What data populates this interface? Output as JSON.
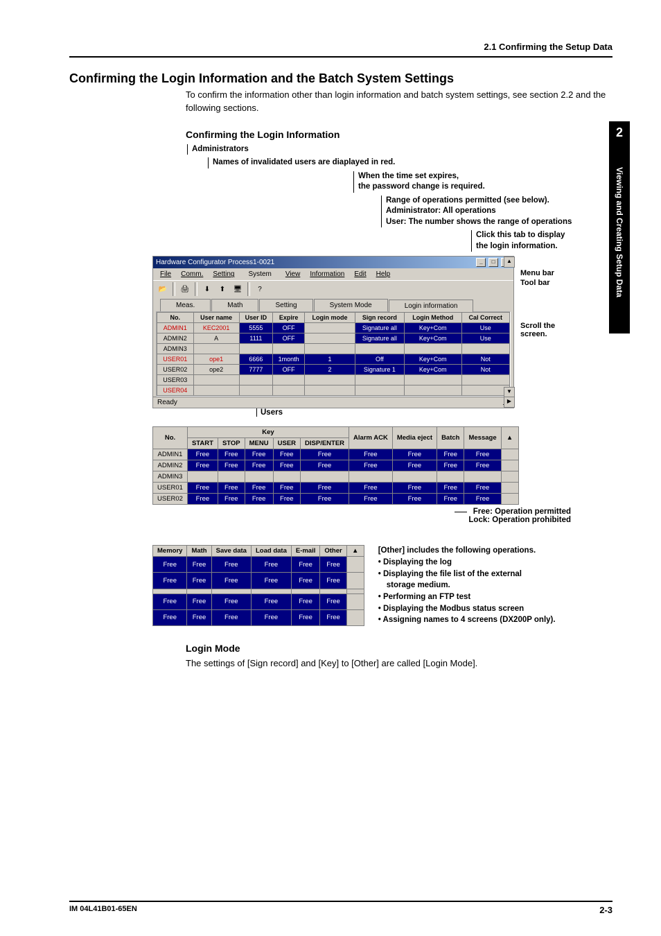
{
  "header": {
    "section": "2.1  Confirming the Setup Data"
  },
  "main_heading": "Confirming the Login Information and the Batch System Settings",
  "intro": "To confirm the information other than login information and batch system settings, see section 2.2 and the following sections.",
  "sub_heading": "Confirming the Login Information",
  "callouts": {
    "administrators": "Administrators",
    "invalid_users": "Names of invalidated users are diaplayed in red.",
    "expire1": "When the time set expires,",
    "expire2": "the password change is required.",
    "range1": "Range of operations permitted (see below).",
    "range2": "Administrator: All operations",
    "range3": "User: The number shows the range of operations",
    "click1": "Click this tab to display",
    "click2": "the login information.",
    "menubar": "Menu bar",
    "toolbar": "Tool bar",
    "scroll1": "Scroll the",
    "scroll2": "screen.",
    "users": "Users"
  },
  "window": {
    "title": "Hardware Configurator Process1-0021",
    "menus": [
      "File",
      "Comm.",
      "Setting",
      "System",
      "View",
      "Information",
      "Edit",
      "Help"
    ],
    "tabs": [
      "Meas.",
      "Math",
      "Setting",
      "System Mode",
      "Login information"
    ],
    "status": "Ready"
  },
  "login_table": {
    "headers": [
      "No.",
      "User name",
      "User ID",
      "Expire",
      "Login mode",
      "Sign record",
      "Login Method",
      "Cal Correct"
    ],
    "rows": [
      {
        "no": "ADMIN1",
        "user": "KEC2001",
        "uid": "5555",
        "exp": "OFF",
        "lm": "",
        "sr": "Signature all",
        "lmeth": "Key+Com",
        "cc": "Use",
        "red": true
      },
      {
        "no": "ADMIN2",
        "user": "A",
        "uid": "1111",
        "exp": "OFF",
        "lm": "",
        "sr": "Signature all",
        "lmeth": "Key+Com",
        "cc": "Use",
        "red": false
      },
      {
        "no": "ADMIN3",
        "user": "",
        "uid": "",
        "exp": "",
        "lm": "",
        "sr": "",
        "lmeth": "",
        "cc": "",
        "red": false
      },
      {
        "no": "USER01",
        "user": "ope1",
        "uid": "6666",
        "exp": "1month",
        "lm": "1",
        "sr": "Off",
        "lmeth": "Key+Com",
        "cc": "Not",
        "red": true
      },
      {
        "no": "USER02",
        "user": "ope2",
        "uid": "7777",
        "exp": "OFF",
        "lm": "2",
        "sr": "Signature 1",
        "lmeth": "Key+Com",
        "cc": "Not",
        "red": false
      },
      {
        "no": "USER03",
        "user": "",
        "uid": "",
        "exp": "",
        "lm": "",
        "sr": "",
        "lmeth": "",
        "cc": "",
        "red": false
      },
      {
        "no": "USER04",
        "user": "",
        "uid": "",
        "exp": "",
        "lm": "",
        "sr": "",
        "lmeth": "",
        "cc": "",
        "red": true
      }
    ]
  },
  "key_table": {
    "header_top": "Key",
    "headers": [
      "No.",
      "START",
      "STOP",
      "MENU",
      "USER",
      "DISP/ENTER",
      "Alarm ACK",
      "Media eject",
      "Batch",
      "Message"
    ],
    "rows": [
      {
        "no": "ADMIN1",
        "cells": [
          "Free",
          "Free",
          "Free",
          "Free",
          "Free",
          "Free",
          "Free",
          "Free",
          "Free"
        ]
      },
      {
        "no": "ADMIN2",
        "cells": [
          "Free",
          "Free",
          "Free",
          "Free",
          "Free",
          "Free",
          "Free",
          "Free",
          "Free"
        ]
      },
      {
        "no": "ADMIN3",
        "cells": [
          "",
          "",
          "",
          "",
          "",
          "",
          "",
          "",
          ""
        ]
      },
      {
        "no": "USER01",
        "cells": [
          "Free",
          "Free",
          "Free",
          "Free",
          "Free",
          "Free",
          "Free",
          "Free",
          "Free"
        ]
      },
      {
        "no": "USER02",
        "cells": [
          "Free",
          "Free",
          "Free",
          "Free",
          "Free",
          "Free",
          "Free",
          "Free",
          "Free"
        ]
      }
    ]
  },
  "legend": {
    "free": "Free: Operation permitted",
    "lock": "Lock: Operation prohibited"
  },
  "mem_table": {
    "headers": [
      "Memory",
      "Math",
      "Save data",
      "Load data",
      "E-mail",
      "Other"
    ],
    "rows": [
      [
        "Free",
        "Free",
        "Free",
        "Free",
        "Free",
        "Free"
      ],
      [
        "Free",
        "Free",
        "Free",
        "Free",
        "Free",
        "Free"
      ],
      [
        "",
        "",
        "",
        "",
        "",
        ""
      ],
      [
        "Free",
        "Free",
        "Free",
        "Free",
        "Free",
        "Free"
      ],
      [
        "Free",
        "Free",
        "Free",
        "Free",
        "Free",
        "Free"
      ]
    ]
  },
  "other": {
    "title": "[Other] includes the following operations.",
    "b1": "• Displaying the log",
    "b2": "• Displaying the file list of the external",
    "b2b": "storage medium.",
    "b3": "• Performing an FTP test",
    "b4": "• Displaying the Modbus status screen",
    "b5": "• Assigning names to 4 screens (DX200P only)."
  },
  "login_mode_heading": "Login Mode",
  "login_mode_text": "The settings of  [Sign record] and [Key] to [Other] are called [Login Mode].",
  "side_tab": {
    "num": "2",
    "text": "Viewing and Creating Setup Data"
  },
  "footer": {
    "manual": "IM 04L41B01-65EN",
    "page": "2-3"
  },
  "chart_data": {
    "type": "table",
    "title": "Login information",
    "columns": [
      "No.",
      "User name",
      "User ID",
      "Expire",
      "Login mode",
      "Sign record",
      "Login Method",
      "Cal Correct"
    ],
    "rows": [
      [
        "ADMIN1",
        "KEC2001",
        "5555",
        "OFF",
        "",
        "Signature all",
        "Key+Com",
        "Use"
      ],
      [
        "ADMIN2",
        "A",
        "1111",
        "OFF",
        "",
        "Signature all",
        "Key+Com",
        "Use"
      ],
      [
        "ADMIN3",
        "",
        "",
        "",
        "",
        "",
        "",
        ""
      ],
      [
        "USER01",
        "ope1",
        "6666",
        "1month",
        "1",
        "Off",
        "Key+Com",
        "Not"
      ],
      [
        "USER02",
        "ope2",
        "7777",
        "OFF",
        "2",
        "Signature 1",
        "Key+Com",
        "Not"
      ],
      [
        "USER03",
        "",
        "",
        "",
        "",
        "",
        "",
        ""
      ],
      [
        "USER04",
        "",
        "",
        "",
        "",
        "",
        "",
        ""
      ]
    ]
  }
}
